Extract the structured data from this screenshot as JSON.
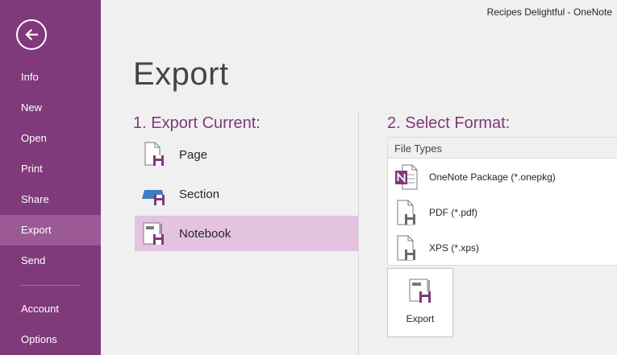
{
  "window": {
    "title": "Recipes Delightful - OneNote"
  },
  "sidebar": {
    "back_icon": "back-arrow-icon",
    "items": [
      {
        "label": "Info"
      },
      {
        "label": "New"
      },
      {
        "label": "Open"
      },
      {
        "label": "Print"
      },
      {
        "label": "Share"
      },
      {
        "label": "Export",
        "active": true
      },
      {
        "label": "Send"
      },
      {
        "label": "Account"
      },
      {
        "label": "Options"
      }
    ]
  },
  "main": {
    "title": "Export",
    "export_current": {
      "heading": "1. Export Current:",
      "options": [
        {
          "label": "Page",
          "icon": "page-icon"
        },
        {
          "label": "Section",
          "icon": "section-icon"
        },
        {
          "label": "Notebook",
          "icon": "notebook-icon",
          "selected": true
        }
      ]
    },
    "select_format": {
      "heading": "2. Select Format:",
      "list_header": "File Types",
      "formats": [
        {
          "label": "OneNote Package (*.onepkg)",
          "icon": "onenote-package-icon"
        },
        {
          "label": "PDF (*.pdf)",
          "icon": "pdf-file-icon"
        },
        {
          "label": "XPS (*.xps)",
          "icon": "xps-file-icon"
        }
      ]
    },
    "export_button": {
      "label": "Export",
      "icon": "export-save-icon"
    }
  },
  "colors": {
    "sidebar_bg": "#80397b",
    "sidebar_active": "#9b5996",
    "accent": "#80397b",
    "selection_bg": "#e3c3e0"
  }
}
